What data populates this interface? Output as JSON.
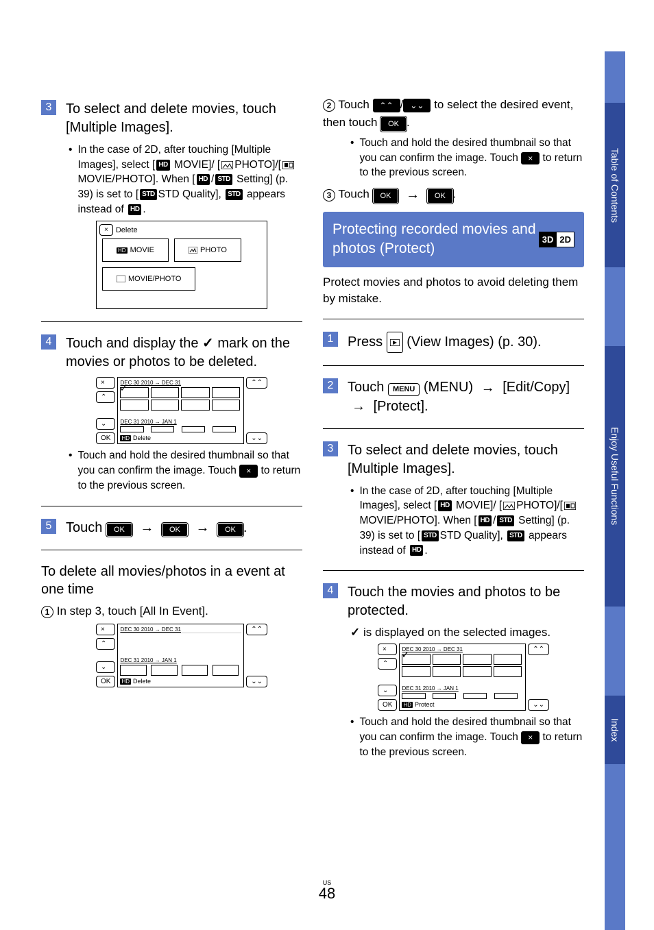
{
  "sidebar": {
    "tableOfContents": "Table of Contents",
    "enjoyUseful": "Enjoy Useful Functions",
    "index": "Index"
  },
  "left": {
    "step3": {
      "num": "3",
      "text": "To select and delete movies, touch [Multiple Images].",
      "bullet": "In the case of 2D, after touching [Multiple Images], select [",
      "bullet_movie": " MOVIE]/ [",
      "bullet_photo": "PHOTO]/[",
      "bullet_movphoto": "MOVIE/PHOTO]. When [",
      "bullet_setting": " Setting] (p. 39) is set to [",
      "bullet_std": "STD Quality], ",
      "bullet_end": " appears instead of "
    },
    "deleteDialog": {
      "close": "×",
      "title": "Delete",
      "movie": "MOVIE",
      "photo": "PHOTO",
      "moviePhoto": "MOVIE/PHOTO"
    },
    "step4": {
      "num": "4",
      "text": "Touch and display the ",
      "text2": " mark on the movies or photos to be deleted."
    },
    "screen1": {
      "date1": "DEC 30 2010 → DEC 31",
      "date2": "DEC 31 2010 → JAN 1",
      "ok": "OK",
      "delete": "Delete"
    },
    "thumbnailNote": "Touch and hold the desired thumbnail so that you can confirm the image. Touch ",
    "thumbnailNote2": " to return to the previous screen.",
    "step5": {
      "num": "5",
      "text": "Touch "
    },
    "ok": "OK",
    "subhead": "To delete all movies/photos in a event at one time",
    "sub1": "In step 3, touch [All In Event].",
    "c1": "1"
  },
  "right": {
    "c2": "2",
    "line2a": "Touch ",
    "line2b": " to select the desired event, then touch ",
    "line2c": ".",
    "thumbnailNote": "Touch and hold the desired thumbnail so that you can confirm the image. Touch ",
    "thumbnailNote2": " to return to the previous screen.",
    "c3": "3",
    "line3a": "Touch ",
    "line3b": ".",
    "blueBox": "Protecting recorded movies and photos (Protect)",
    "tag3d": "3D",
    "tag2d": "2D",
    "intro": "Protect movies and photos to avoid deleting them by mistake.",
    "step1": {
      "num": "1",
      "text": "Press ",
      "text2": " (View Images) (p. 30)."
    },
    "step2": {
      "num": "2",
      "text": "Touch ",
      "menu": "MENU",
      "text2": " (MENU) ",
      "text3": " [Edit/Copy] ",
      "text4": " [Protect]."
    },
    "step3": {
      "num": "3",
      "text": "To select and delete movies, touch [Multiple Images].",
      "bullet": "In the case of 2D, after touching [Multiple Images], select [",
      "bullet_movie": " MOVIE]/ [",
      "bullet_photo": "PHOTO]/[",
      "bullet_movphoto": "MOVIE/PHOTO]. When [",
      "bullet_setting": " Setting] (p. 39) is set to [",
      "bullet_std": "STD Quality], ",
      "bullet_end": " appears instead of "
    },
    "step4": {
      "num": "4",
      "text": "Touch the movies and photos to be protected."
    },
    "checkNote": " is displayed on the selected images.",
    "screen": {
      "date1": "DEC 30 2010 → DEC 31",
      "date2": "DEC 31 2010 → JAN 1",
      "ok": "OK",
      "protect": "Protect"
    },
    "thumbnailNoteB": "Touch and hold the desired thumbnail so that you can confirm the image. Touch ",
    "thumbnailNoteB2": " to return to the previous screen."
  },
  "footer": {
    "us": "US",
    "page": "48"
  }
}
